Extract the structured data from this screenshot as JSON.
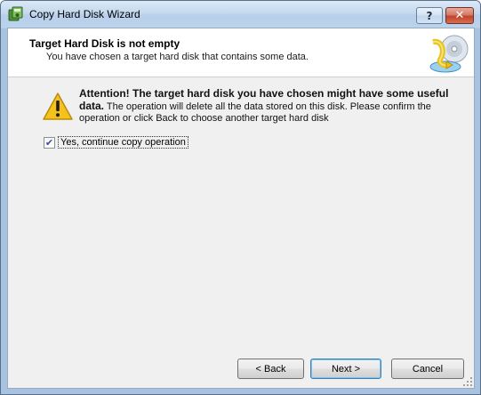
{
  "window": {
    "title": "Copy Hard Disk Wizard",
    "help_label": "?",
    "close_label": "✕"
  },
  "header": {
    "title": "Target Hard Disk is not empty",
    "subtitle": "You have chosen a target hard disk that contains some data."
  },
  "warning": {
    "bold_text": "Attention! The target hard disk you have chosen might have some useful data.",
    "body_text": " The operation will delete all the data stored on this disk. Please confirm the operation or click Back to choose another target hard disk"
  },
  "confirm": {
    "checked": true,
    "label": "Yes, continue copy operation"
  },
  "buttons": {
    "back": "< Back",
    "next": "Next >",
    "cancel": "Cancel"
  },
  "icons": {
    "app": "disk-copy-icon",
    "warning": "warning-triangle-icon",
    "header": "disk-wizard-graphic"
  },
  "colors": {
    "accent": "#3c7fb1",
    "warning_fill": "#f5c21b",
    "close_red": "#c2432c"
  }
}
